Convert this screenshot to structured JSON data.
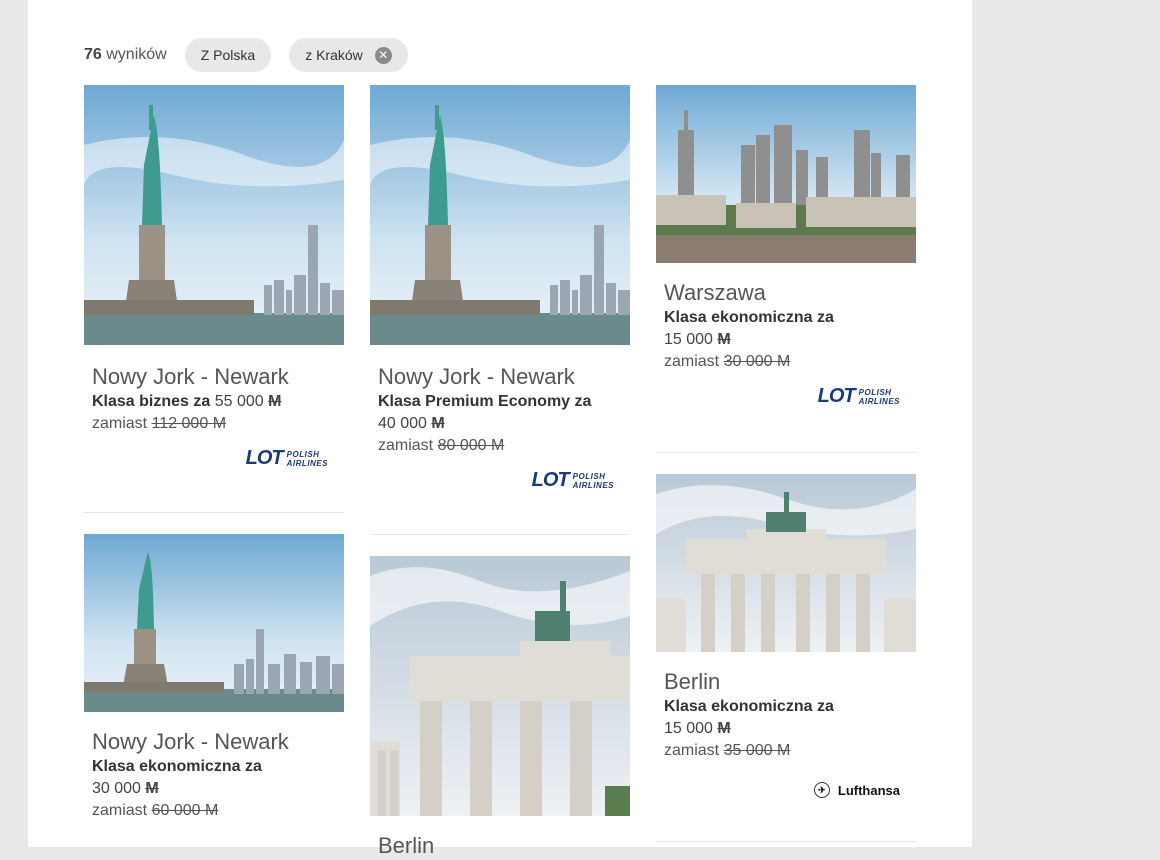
{
  "filters": {
    "count": "76",
    "count_label": "wyników",
    "chips": [
      {
        "label": "Z Polska"
      },
      {
        "label": "z Kraków",
        "removable": true
      }
    ]
  },
  "cards": [
    {
      "city": "Nowy Jork - Newark",
      "class_label": "Klasa biznes za",
      "price": "55 000",
      "was_label": "zamiast",
      "was_price": "112 000",
      "miles_symbol": "M",
      "airline": "LOT",
      "airline_line1": "POLISH",
      "airline_line2": "AIRLINES",
      "image": "statue-of-liberty"
    },
    {
      "city": "Nowy Jork - Newark",
      "class_label": "Klasa Premium Economy za",
      "price": "40 000",
      "was_label": "zamiast",
      "was_price": "80 000",
      "miles_symbol": "M",
      "airline": "LOT",
      "airline_line1": "POLISH",
      "airline_line2": "AIRLINES",
      "image": "statue-of-liberty"
    },
    {
      "city": "Warszawa",
      "class_label": "Klasa ekonomiczna za",
      "price": "15 000",
      "was_label": "zamiast",
      "was_price": "30 000",
      "miles_symbol": "M",
      "airline": "LOT",
      "airline_line1": "POLISH",
      "airline_line2": "AIRLINES",
      "image": "warsaw-skyline"
    },
    {
      "city": "Nowy Jork - Newark",
      "class_label": "Klasa ekonomiczna za",
      "price": "30 000",
      "was_label": "zamiast",
      "was_price": "60 000",
      "miles_symbol": "M",
      "image": "statue-of-liberty"
    },
    {
      "city": "Berlin",
      "image": "brandenburg-gate"
    },
    {
      "city": "Berlin",
      "class_label": "Klasa ekonomiczna za",
      "price": "15 000",
      "was_label": "zamiast",
      "was_price": "35 000",
      "miles_symbol": "M",
      "airline": "Lufthansa",
      "image": "brandenburg-gate"
    }
  ]
}
